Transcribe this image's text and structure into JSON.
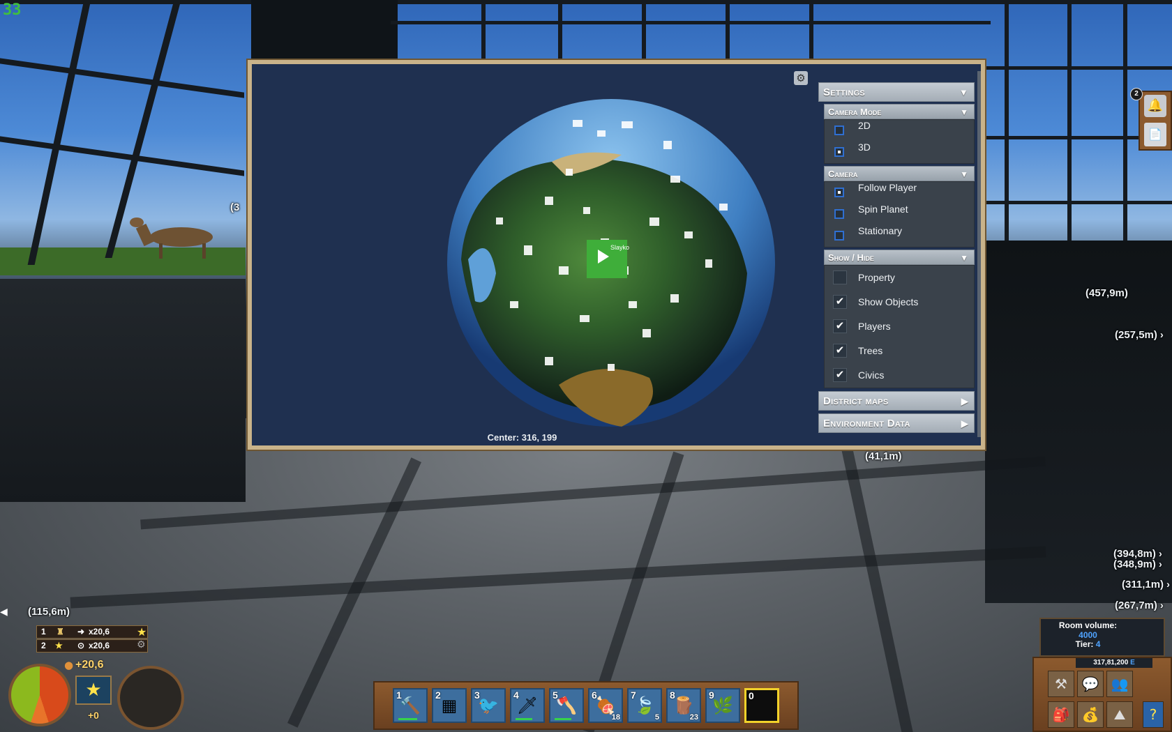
{
  "hud": {
    "fps": "33",
    "distance_markers": [
      "(457,9m)",
      "(257,5m)",
      "(41,1m)",
      "(394,8m)",
      "(348,9m)",
      "(311,1m)",
      "(267,7m)",
      "(115,6m)",
      "(3"
    ],
    "reputation": [
      {
        "rank": "1",
        "value": "x20,6"
      },
      {
        "rank": "2",
        "value": "x20,6"
      }
    ],
    "food_gain": "+20,6",
    "rep_gain": "+0",
    "notification_count": "2"
  },
  "map": {
    "center_label": "Center: 316, 199",
    "player_name": "Slayko",
    "settings": {
      "title": "Settings",
      "camera_mode": {
        "title": "Camera Mode",
        "options": [
          {
            "label": "2D",
            "selected": false
          },
          {
            "label": "3D",
            "selected": true
          }
        ]
      },
      "camera": {
        "title": "Camera",
        "options": [
          {
            "label": "Follow Player",
            "selected": true
          },
          {
            "label": "Spin Planet",
            "selected": false
          },
          {
            "label": "Stationary",
            "selected": false
          }
        ]
      },
      "show_hide": {
        "title": "Show / Hide",
        "options": [
          {
            "label": "Property",
            "checked": false
          },
          {
            "label": "Show Objects",
            "checked": true
          },
          {
            "label": "Players",
            "checked": true
          },
          {
            "label": "Trees",
            "checked": true
          },
          {
            "label": "Civics",
            "checked": true
          }
        ]
      }
    },
    "district_maps": "District maps",
    "environment_data": "Environment Data"
  },
  "hotbar": {
    "slots": [
      {
        "num": "1",
        "icon": "hammer-icon",
        "count": "",
        "durability": 0.8
      },
      {
        "num": "2",
        "icon": "block-icon",
        "count": "",
        "durability": 0
      },
      {
        "num": "3",
        "icon": "bird-icon",
        "count": "",
        "durability": 0
      },
      {
        "num": "4",
        "icon": "machete-icon",
        "count": "",
        "durability": 0.7
      },
      {
        "num": "5",
        "icon": "axe-icon",
        "count": "",
        "durability": 0.7
      },
      {
        "num": "6",
        "icon": "meat-icon",
        "count": "18",
        "durability": 0
      },
      {
        "num": "7",
        "icon": "leaf-icon",
        "count": "5",
        "durability": 0
      },
      {
        "num": "8",
        "icon": "logs-icon",
        "count": "23",
        "durability": 0
      },
      {
        "num": "9",
        "icon": "plant-icon",
        "count": "",
        "durability": 0
      },
      {
        "num": "0",
        "icon": "",
        "count": "",
        "durability": 0,
        "selected": true
      }
    ]
  },
  "room": {
    "volume_label": "Room volume:",
    "volume_value": "4000",
    "tier_label": "Tier:",
    "tier_value": "4",
    "money": "317,81,200",
    "currency": "E"
  },
  "colors": {
    "accent_blue": "#2f6fd1",
    "panel_header": "#a4adb6",
    "hud_wood": "#8c5a2e",
    "selected_slot": "#f2d22a"
  }
}
